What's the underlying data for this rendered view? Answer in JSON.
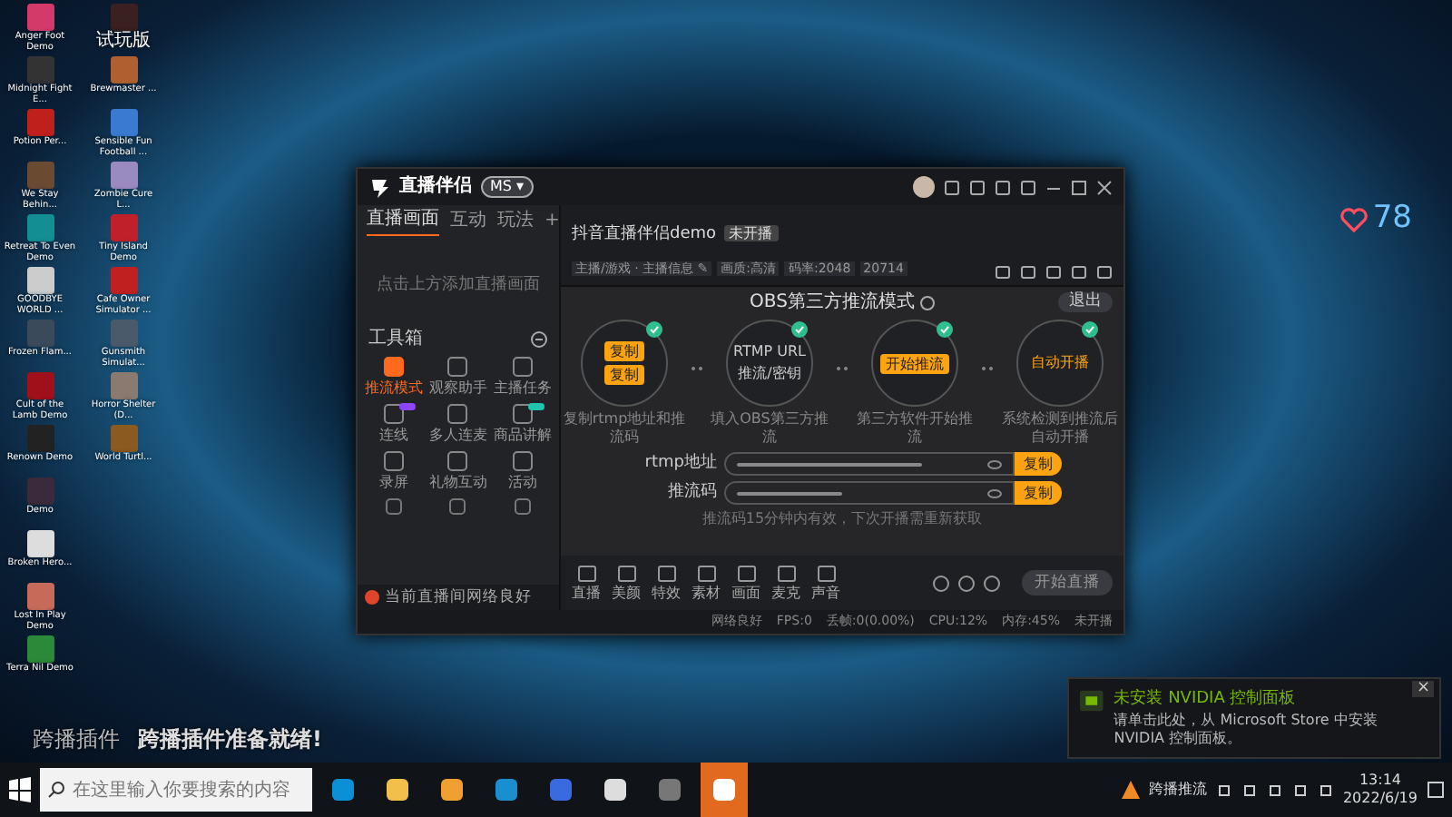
{
  "desktop_icons": [
    {
      "label": "Anger Foot Demo"
    },
    {
      "label": "Midnight Fight E..."
    },
    {
      "label": "Potion Per..."
    },
    {
      "label": "We Stay Behin..."
    },
    {
      "label": "Retreat To Even Demo"
    },
    {
      "label": "GOODBYE WORLD ..."
    },
    {
      "label": "Frozen Flam..."
    },
    {
      "label": "Cult of the Lamb Demo"
    },
    {
      "label": "Renown Demo"
    },
    {
      "label": "Demo"
    },
    {
      "label": "Broken Hero..."
    },
    {
      "label": "Lost In Play Demo"
    },
    {
      "label": "Terra Nil Demo"
    },
    {
      "label": "试玩版"
    },
    {
      "label": "Brewmaster ..."
    },
    {
      "label": "Sensible Fun Football ..."
    },
    {
      "label": "Zombie Cure L..."
    },
    {
      "label": "Tiny Island Demo"
    },
    {
      "label": "Cafe Owner Simulator ..."
    },
    {
      "label": "Gunsmith Simulat..."
    },
    {
      "label": "Horror Shelter (D..."
    },
    {
      "label": "World Turtl..."
    }
  ],
  "app": {
    "title": "直播伴侣",
    "version_badge": "MS ▾",
    "left_tabs": [
      {
        "label": "直播画面",
        "selected": true
      },
      {
        "label": "互动",
        "selected": false
      },
      {
        "label": "玩法",
        "selected": false
      }
    ],
    "add_tab": "+",
    "empty_hint": "点击上方添加直播画面",
    "toolbox_title": "工具箱",
    "tools": [
      {
        "label": "推流模式",
        "selected": true
      },
      {
        "label": "观察助手",
        "selected": false
      },
      {
        "label": "主播任务",
        "selected": false
      },
      {
        "label": "连线",
        "selected": false,
        "color": "#8e44ff"
      },
      {
        "label": "多人连麦",
        "selected": false
      },
      {
        "label": "商品讲解",
        "selected": false,
        "color": "#20c4b0"
      },
      {
        "label": "录屏",
        "selected": false
      },
      {
        "label": "礼物互动",
        "selected": false
      },
      {
        "label": "活动",
        "selected": false
      }
    ],
    "status_notice": "当前直播间网络良好",
    "room_title": "抖音直播伴侣demo",
    "room_badge": "未开播",
    "meta": [
      "主播/游戏 · 主播信息 ✎",
      "画质:高清",
      "码率:2048",
      "20714"
    ],
    "mode_title": "OBS第三方推流模式",
    "exit_button": "退出",
    "steps": [
      {
        "kind": "copy-pair",
        "buttons": [
          "复制",
          "复制"
        ],
        "caption": "复制rtmp地址和推流码",
        "done": true
      },
      {
        "kind": "text-pair",
        "lines": [
          "RTMP URL",
          "推流/密钥"
        ],
        "caption": "填入OBS第三方推流",
        "done": true
      },
      {
        "kind": "button",
        "button": "开始推流",
        "caption": "第三方软件开始推流",
        "done": true
      },
      {
        "kind": "text",
        "text": "自动开播",
        "caption": "系统检测到推流后自动开播",
        "done": true
      }
    ],
    "fields": [
      {
        "label": "rtmp地址",
        "button": "复制"
      },
      {
        "label": "推流码",
        "button": "复制"
      }
    ],
    "note": "推流码15分钟内有效，下次开播需重新获取",
    "bottom_tools": [
      {
        "label": "直播"
      },
      {
        "label": "美颜"
      },
      {
        "label": "特效"
      },
      {
        "label": "素材"
      },
      {
        "label": "画面"
      },
      {
        "label": "麦克"
      },
      {
        "label": "声音"
      }
    ],
    "start_button": "开始直播",
    "status_bar": [
      "网络良好",
      "FPS:0",
      "丢帧:0(0.00%)",
      "CPU:12%",
      "内存:45%",
      "未开播"
    ]
  },
  "heart_count": "78",
  "plugin_label": "跨播插件",
  "plugin_message": "跨播插件准备就绪!",
  "notification": {
    "title": "未安装 NVIDIA 控制面板",
    "body": "请单击此处，从 Microsoft Store 中安装 NVIDIA 控制面板。",
    "close": "×"
  },
  "taskbar": {
    "search_placeholder": "在这里输入你要搜索的内容",
    "apps": [
      {
        "selected": false
      },
      {
        "selected": false
      },
      {
        "selected": false
      },
      {
        "selected": false
      },
      {
        "selected": false
      },
      {
        "selected": false
      },
      {
        "selected": false
      },
      {
        "selected": true
      }
    ],
    "tray_label": "跨播推流",
    "time": "13:14",
    "date": "2022/6/19"
  }
}
